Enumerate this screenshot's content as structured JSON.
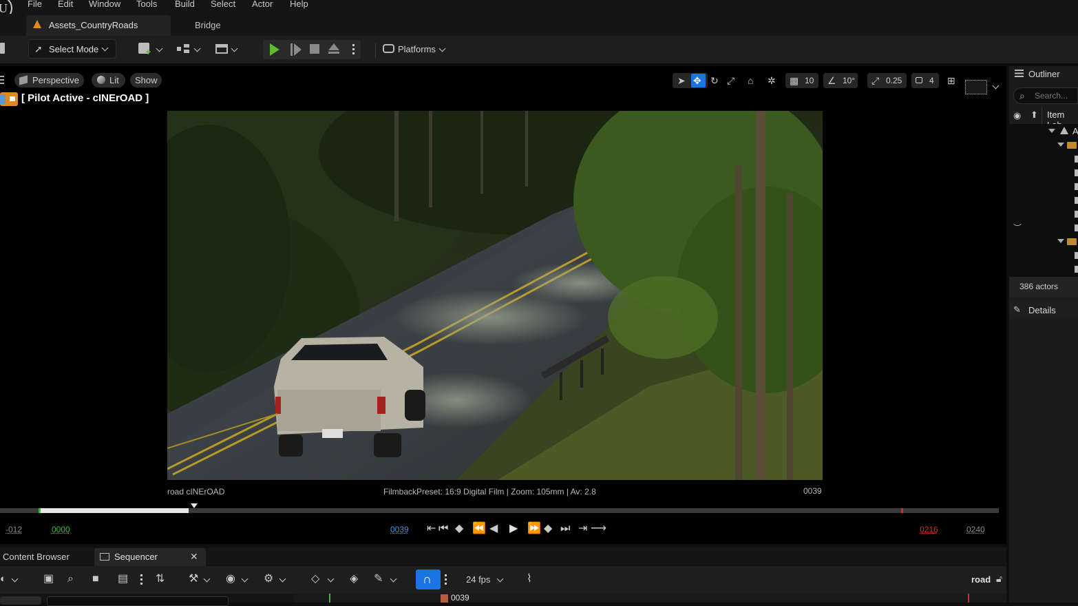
{
  "menu": [
    "File",
    "Edit",
    "Window",
    "Tools",
    "Build",
    "Select",
    "Actor",
    "Help"
  ],
  "tabs": {
    "level": "Assets_CountryRoads",
    "bridge": "Bridge"
  },
  "toolbar": {
    "select_mode": "Select Mode",
    "platforms": "Platforms"
  },
  "viewport": {
    "view_mode": "Perspective",
    "lighting": "Lit",
    "show": "Show",
    "pilot_label": "[ Pilot Active - cINErOAD ]",
    "grid_snap": "10",
    "rotation_snap": "10°",
    "scale_snap": "0.25",
    "camera_speed": "4",
    "camera_name": "road  cINErOAD",
    "filmback_info": "FilmbackPreset: 16:9 Digital Film | Zoom: 105mm | Av: 2.8",
    "frame_display": "0039"
  },
  "timeline": {
    "start_offset": "-012",
    "start": "0000",
    "current": "0039",
    "end": "0216",
    "end_offset": "0240",
    "played_fraction": 0.155
  },
  "bottom": {
    "tabs": [
      "Content Browser",
      "Sequencer"
    ],
    "fps": "24 fps",
    "sequence_name": "road",
    "track_frame": "0039"
  },
  "outliner": {
    "title": "Outliner",
    "search_placeholder": "Search...",
    "column": "Item Lab",
    "tree_first": "A",
    "actor_count": "386 actors"
  },
  "details": {
    "title": "Details"
  },
  "colors": {
    "accent_blue": "#1b74e4",
    "play_green": "#5cbb2e",
    "warning_orange": "#e08a1e",
    "end_red": "#c8312f",
    "start_green": "#3cb83c"
  }
}
